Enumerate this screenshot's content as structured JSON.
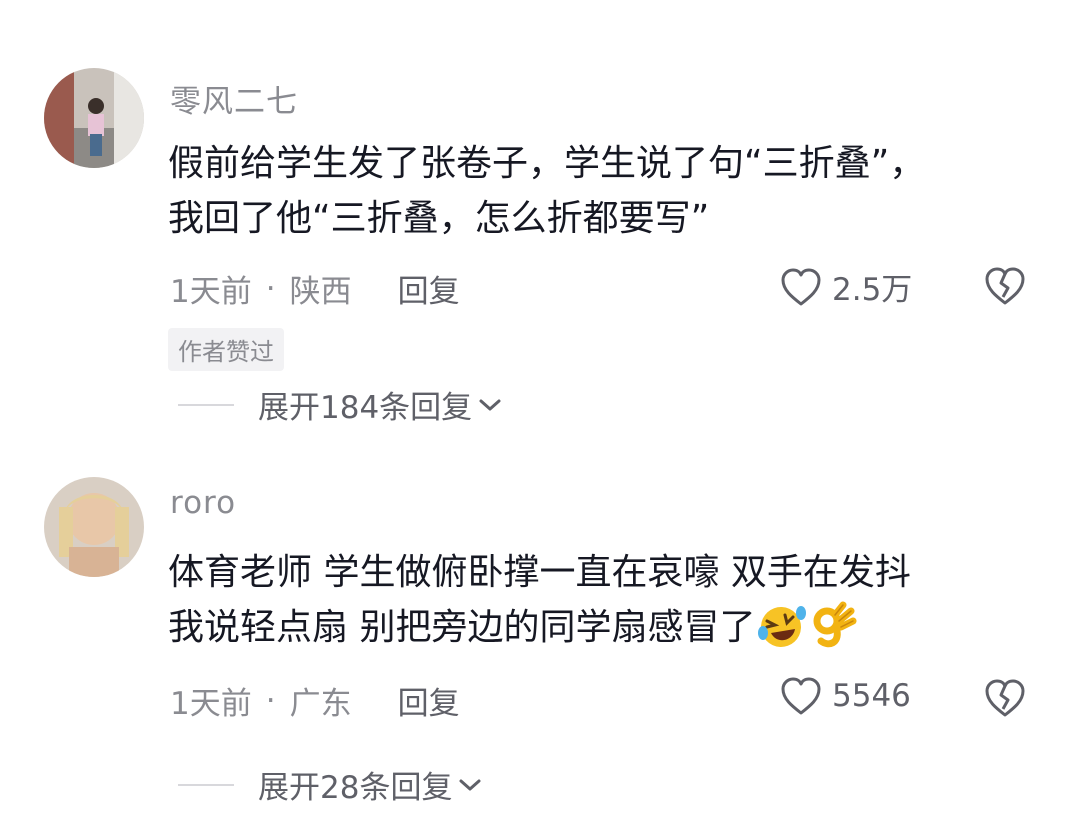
{
  "comments": [
    {
      "username": "零风二七",
      "text_lines": [
        "假前给学生发了张卷子，学生说了句“三折叠”，",
        "我回了他“三折叠，怎么折都要写”"
      ],
      "time": "1天前",
      "dot": "·",
      "location": "陕西",
      "reply_label": "回复",
      "likes": "2.5万",
      "badge": "作者赞过",
      "expand_label": "展开184条回复"
    },
    {
      "username": "roro",
      "text_lines": [
        "体育老师 学生做俯卧撑一直在哀嚎 双手在发抖",
        "我说轻点扇 别把旁边的同学扇感冒了"
      ],
      "emojis": [
        "laughing-crying-emoji",
        "ok-hand-emoji"
      ],
      "time": "1天前",
      "dot": "·",
      "location": "广东",
      "reply_label": "回复",
      "likes": "5546",
      "expand_label": "展开28条回复"
    }
  ]
}
